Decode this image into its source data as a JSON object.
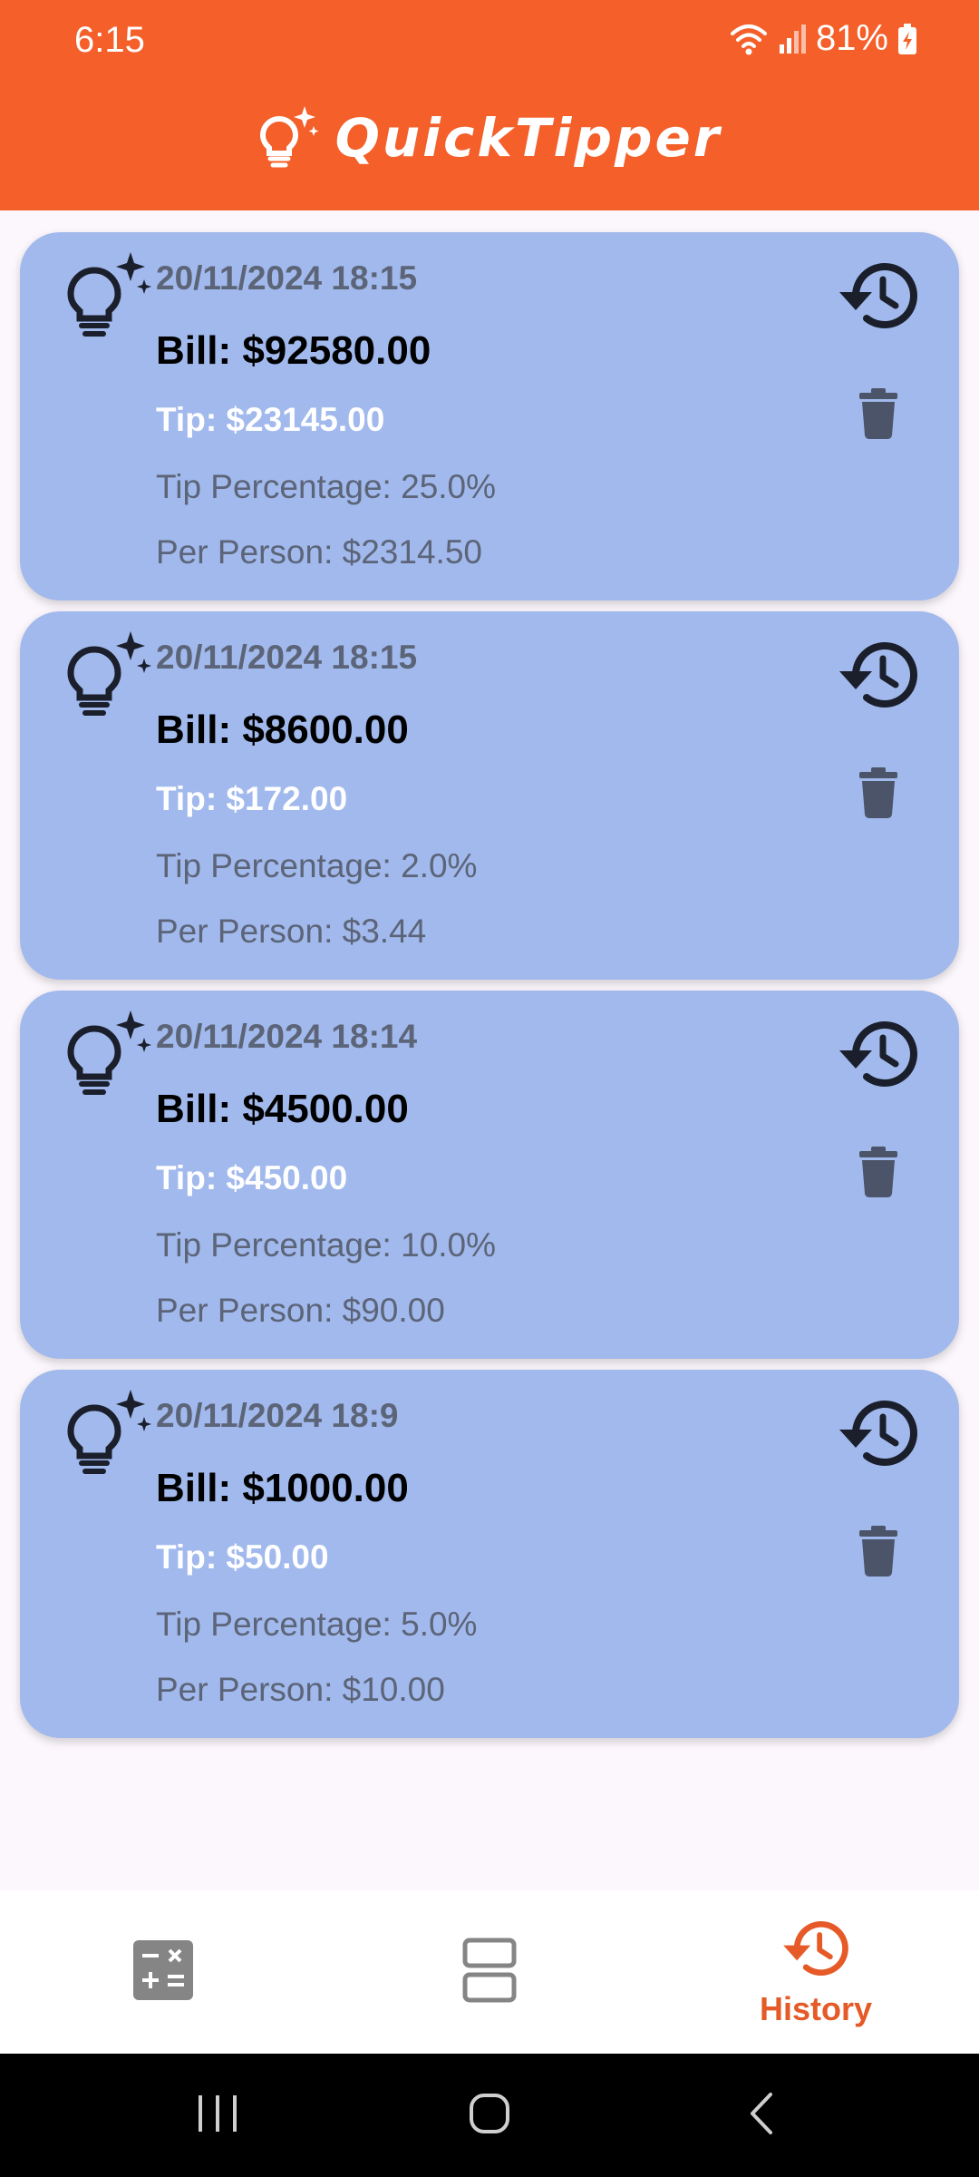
{
  "status": {
    "time": "6:15",
    "battery": "81%"
  },
  "app": {
    "title": "QuickTipper",
    "accent_color": "#f45f2a",
    "card_color": "#a1b9ec"
  },
  "history": [
    {
      "date": "20/11/2024 18:15",
      "bill": "Bill: $92580.00",
      "tip": "Tip: $23145.00",
      "tip_percentage": "Tip Percentage: 25.0%",
      "per_person": "Per Person: $2314.50"
    },
    {
      "date": "20/11/2024 18:15",
      "bill": "Bill: $8600.00",
      "tip": "Tip: $172.00",
      "tip_percentage": "Tip Percentage: 2.0%",
      "per_person": "Per Person: $3.44"
    },
    {
      "date": "20/11/2024 18:14",
      "bill": "Bill: $4500.00",
      "tip": "Tip: $450.00",
      "tip_percentage": "Tip Percentage: 10.0%",
      "per_person": "Per Person: $90.00"
    },
    {
      "date": "20/11/2024 18:9",
      "bill": "Bill: $1000.00",
      "tip": "Tip: $50.00",
      "tip_percentage": "Tip Percentage: 5.0%",
      "per_person": "Per Person: $10.00"
    }
  ],
  "bottom_nav": {
    "items": [
      {
        "icon": "calculator-icon",
        "label": ""
      },
      {
        "icon": "split-view-icon",
        "label": ""
      },
      {
        "icon": "history-icon",
        "label": "History",
        "selected": true
      }
    ]
  },
  "system_nav": {
    "icons": [
      "recents-icon",
      "home-icon",
      "back-icon"
    ]
  }
}
